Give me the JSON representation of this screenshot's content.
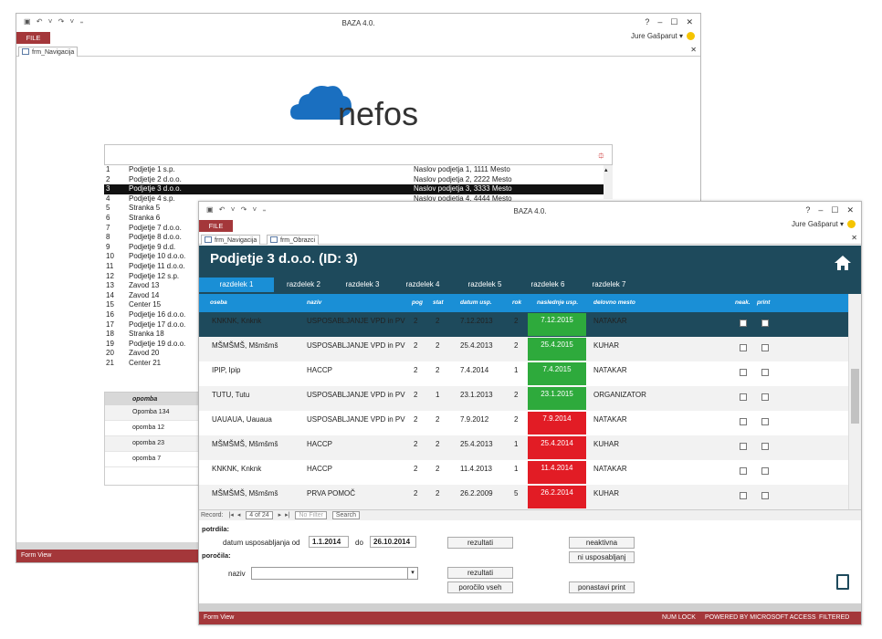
{
  "w1": {
    "title": "BAZA 4.0.",
    "file_label": "FILE",
    "user": "Jure Gašparut",
    "tab": "frm_Navigacija",
    "logo_text": "nefos",
    "list": [
      {
        "n": "1",
        "name": "Podjetje 1 s.p.",
        "addr": "Naslov podjetja 1, 1111 Mesto"
      },
      {
        "n": "2",
        "name": "Podjetje 2 d.o.o.",
        "addr": "Naslov podjetja 2, 2222 Mesto"
      },
      {
        "n": "3",
        "name": "Podjetje 3 d.o.o.",
        "addr": "Naslov podjetja 3, 3333 Mesto"
      },
      {
        "n": "4",
        "name": "Podjetje 4 s.p.",
        "addr": "Naslov podjetja 4, 4444 Mesto"
      },
      {
        "n": "5",
        "name": "Stranka 5",
        "addr": ""
      },
      {
        "n": "6",
        "name": "Stranka 6",
        "addr": ""
      },
      {
        "n": "7",
        "name": "Podjetje 7 d.o.o.",
        "addr": ""
      },
      {
        "n": "8",
        "name": "Podjetje 8 d.o.o.",
        "addr": ""
      },
      {
        "n": "9",
        "name": "Podjetje 9 d.d.",
        "addr": ""
      },
      {
        "n": "10",
        "name": "Podjetje 10 d.o.o.",
        "addr": ""
      },
      {
        "n": "11",
        "name": "Podjetje 11 d.o.o.",
        "addr": ""
      },
      {
        "n": "12",
        "name": "Podjetje 12 s.p.",
        "addr": ""
      },
      {
        "n": "13",
        "name": "Zavod 13",
        "addr": ""
      },
      {
        "n": "14",
        "name": "Zavod 14",
        "addr": ""
      },
      {
        "n": "15",
        "name": "Center 15",
        "addr": ""
      },
      {
        "n": "16",
        "name": "Podjetje 16 d.o.o.",
        "addr": ""
      },
      {
        "n": "17",
        "name": "Podjetje 17 d.o.o.",
        "addr": ""
      },
      {
        "n": "18",
        "name": "Stranka 18",
        "addr": ""
      },
      {
        "n": "19",
        "name": "Podjetje 19 d.o.o.",
        "addr": ""
      },
      {
        "n": "20",
        "name": "Zavod 20",
        "addr": ""
      },
      {
        "n": "21",
        "name": "Center 21",
        "addr": ""
      }
    ],
    "opomba_header": "opomba",
    "opombe": [
      "Opomba 134",
      "opomba 12",
      "opomba 23",
      "opomba 7"
    ],
    "status": "Form View"
  },
  "w2": {
    "title": "BAZA 4.0.",
    "file_label": "FILE",
    "user": "Jure Gašparut",
    "tab1": "frm_Navigacija",
    "tab2": "frm_Obrazci",
    "heading": "Podjetje 3 d.o.o. (ID: 3)",
    "tabs": [
      "razdelek 1",
      "razdelek 2",
      "razdelek 3",
      "razdelek 4",
      "razdelek 5",
      "razdelek 6",
      "razdelek 7"
    ],
    "columns": {
      "oseba": "oseba",
      "naziv": "naziv",
      "pog": "pog",
      "stat": "stat",
      "datum": "datum usp.",
      "rok": "rok",
      "naslednje": "naslednje usp.",
      "mesto": "delovno mesto",
      "neak": "neak.",
      "print": "print"
    },
    "rows": [
      {
        "oseba": "KNKNK, Knknk",
        "naziv": "USPOSABLJANJE VPD in PV",
        "pog": "2",
        "stat": "2",
        "datum": "7.12.2013",
        "rok": "2",
        "nasl": "7.12.2015",
        "ok": true,
        "mesto": "NATAKAR"
      },
      {
        "oseba": "MŠMŠMŠ, Mšmšmš",
        "naziv": "USPOSABLJANJE VPD in PV",
        "pog": "2",
        "stat": "2",
        "datum": "25.4.2013",
        "rok": "2",
        "nasl": "25.4.2015",
        "ok": true,
        "mesto": "KUHAR"
      },
      {
        "oseba": "IPIP, Ipip",
        "naziv": "HACCP",
        "pog": "2",
        "stat": "2",
        "datum": "7.4.2014",
        "rok": "1",
        "nasl": "7.4.2015",
        "ok": true,
        "mesto": "NATAKAR"
      },
      {
        "oseba": "TUTU, Tutu",
        "naziv": "USPOSABLJANJE VPD in PV",
        "pog": "2",
        "stat": "1",
        "datum": "23.1.2013",
        "rok": "2",
        "nasl": "23.1.2015",
        "ok": true,
        "mesto": "ORGANIZATOR"
      },
      {
        "oseba": "UAUAUA, Uauaua",
        "naziv": "USPOSABLJANJE VPD in PV",
        "pog": "2",
        "stat": "2",
        "datum": "7.9.2012",
        "rok": "2",
        "nasl": "7.9.2014",
        "ok": false,
        "mesto": "NATAKAR"
      },
      {
        "oseba": "MŠMŠMŠ, Mšmšmš",
        "naziv": "HACCP",
        "pog": "2",
        "stat": "2",
        "datum": "25.4.2013",
        "rok": "1",
        "nasl": "25.4.2014",
        "ok": false,
        "mesto": "KUHAR"
      },
      {
        "oseba": "KNKNK, Knknk",
        "naziv": "HACCP",
        "pog": "2",
        "stat": "2",
        "datum": "11.4.2013",
        "rok": "1",
        "nasl": "11.4.2014",
        "ok": false,
        "mesto": "NATAKAR"
      },
      {
        "oseba": "MŠMŠMŠ, Mšmšmš",
        "naziv": "PRVA POMOČ",
        "pog": "2",
        "stat": "2",
        "datum": "26.2.2009",
        "rok": "5",
        "nasl": "26.2.2014",
        "ok": false,
        "mesto": "KUHAR"
      }
    ],
    "nav": {
      "record": "Record:",
      "pos": "4 of 24",
      "filter": "No Filter",
      "search": "Search"
    },
    "footer": {
      "potrdila": "potrdila:",
      "datum_label": "datum usposabljanja od",
      "od": "1.1.2014",
      "do_label": "do",
      "do": "26.10.2014",
      "rezultati1": "rezultati",
      "neaktivna": "neaktivna",
      "ni_usp": "ni usposabljanj",
      "porocila": "poročila:",
      "naziv_label": "naziv",
      "rezultati2": "rezultati",
      "porocilo_vseh": "poročilo vseh",
      "ponastavi": "ponastavi print"
    },
    "status_left": "Form View",
    "status_right": [
      "NUM LOCK",
      "POWERED BY MICROSOFT ACCESS",
      "FILTERED"
    ]
  },
  "colors": {
    "access_red": "#a4373a",
    "header_blue": "#1e4a5c",
    "accent_blue": "#1a8fd6",
    "ok_green": "#2eaa3c",
    "bad_red": "#e21c25"
  }
}
